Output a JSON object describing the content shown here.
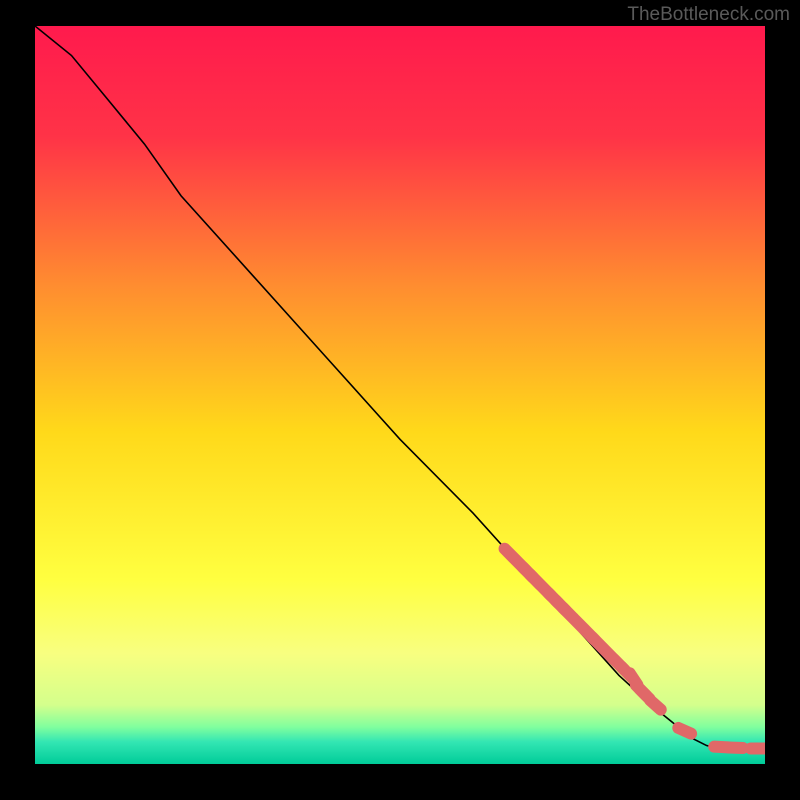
{
  "watermark": "TheBottleneck.com",
  "chart_data": {
    "type": "line",
    "title": "",
    "xlabel": "",
    "ylabel": "",
    "xlim": [
      0,
      100
    ],
    "ylim": [
      0,
      100
    ],
    "background_gradient": {
      "stops": [
        {
          "offset": 0,
          "color": "#ff1a4d"
        },
        {
          "offset": 15,
          "color": "#ff3347"
        },
        {
          "offset": 35,
          "color": "#ff8c30"
        },
        {
          "offset": 55,
          "color": "#ffd91a"
        },
        {
          "offset": 75,
          "color": "#ffff40"
        },
        {
          "offset": 85,
          "color": "#f8ff80"
        },
        {
          "offset": 92,
          "color": "#d4ff8c"
        },
        {
          "offset": 95,
          "color": "#80ff9e"
        },
        {
          "offset": 97,
          "color": "#33e6b3"
        },
        {
          "offset": 100,
          "color": "#00cc99"
        }
      ]
    },
    "series": [
      {
        "name": "curve",
        "kind": "line",
        "x": [
          0,
          5,
          10,
          15,
          20,
          30,
          40,
          50,
          60,
          70,
          80,
          85,
          90,
          92,
          94,
          96,
          98,
          100
        ],
        "y": [
          100,
          96,
          90,
          84,
          77,
          66,
          55,
          44,
          34,
          23,
          12,
          7.5,
          3.5,
          2.5,
          2,
          2,
          2,
          2
        ]
      },
      {
        "name": "points",
        "kind": "scatter",
        "x": [
          65,
          66.5,
          67.5,
          68.5,
          70,
          71,
          72,
          73,
          74.5,
          76,
          77,
          78.5,
          80,
          81,
          82,
          83,
          83.5,
          85,
          89,
          94,
          96,
          99,
          100
        ],
        "y": [
          28.5,
          27,
          26,
          25,
          23.5,
          22.5,
          21.5,
          20.5,
          19,
          17.5,
          16.5,
          15,
          13.5,
          12.5,
          11.5,
          10,
          9.5,
          8,
          4.5,
          2.3,
          2.2,
          2.1,
          2.1
        ]
      }
    ]
  }
}
